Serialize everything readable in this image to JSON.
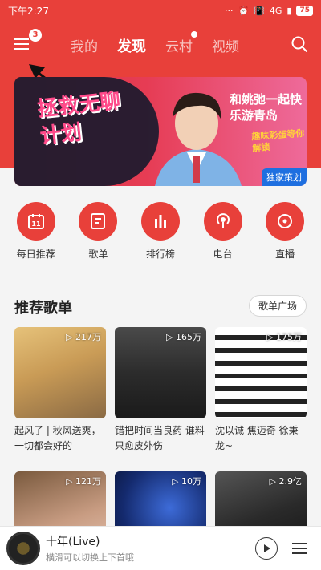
{
  "status": {
    "time": "下午2:27",
    "network": "4G",
    "battery": "75"
  },
  "header": {
    "menu_badge": "3",
    "tabs": [
      {
        "label": "我的",
        "active": false
      },
      {
        "label": "发现",
        "active": true
      },
      {
        "label": "云村",
        "active": false,
        "dot": true
      },
      {
        "label": "视频",
        "active": false
      }
    ]
  },
  "banner": {
    "left_text": "拯救无聊计划",
    "right_title": "和姚弛一起快乐游青岛",
    "right_sub": "趣味彩蛋等你解锁",
    "tag": "独家策划"
  },
  "quick_links": [
    {
      "label": "每日推荐",
      "icon": "calendar-icon",
      "badge": "11"
    },
    {
      "label": "歌单",
      "icon": "playlist-icon"
    },
    {
      "label": "排行榜",
      "icon": "chart-icon"
    },
    {
      "label": "电台",
      "icon": "radio-icon"
    },
    {
      "label": "直播",
      "icon": "live-icon"
    }
  ],
  "section": {
    "title": "推荐歌单",
    "more_label": "歌单广场"
  },
  "playlists": [
    {
      "count": "217万",
      "title": "起风了 | 秋风送爽，一切都会好的"
    },
    {
      "count": "165万",
      "title": "错把时间当良药 谁料只愈皮外伤"
    },
    {
      "count": "175万",
      "title": "沈以诚 焦迈奇 徐秉龙~"
    },
    {
      "count": "121万",
      "title": ""
    },
    {
      "count": "10万",
      "title": ""
    },
    {
      "count": "2.9亿",
      "title": ""
    }
  ],
  "player": {
    "title": "十年(Live)",
    "subtitle": "横滑可以切换上下首哦"
  },
  "colors": {
    "brand_red": "#e8403a"
  }
}
